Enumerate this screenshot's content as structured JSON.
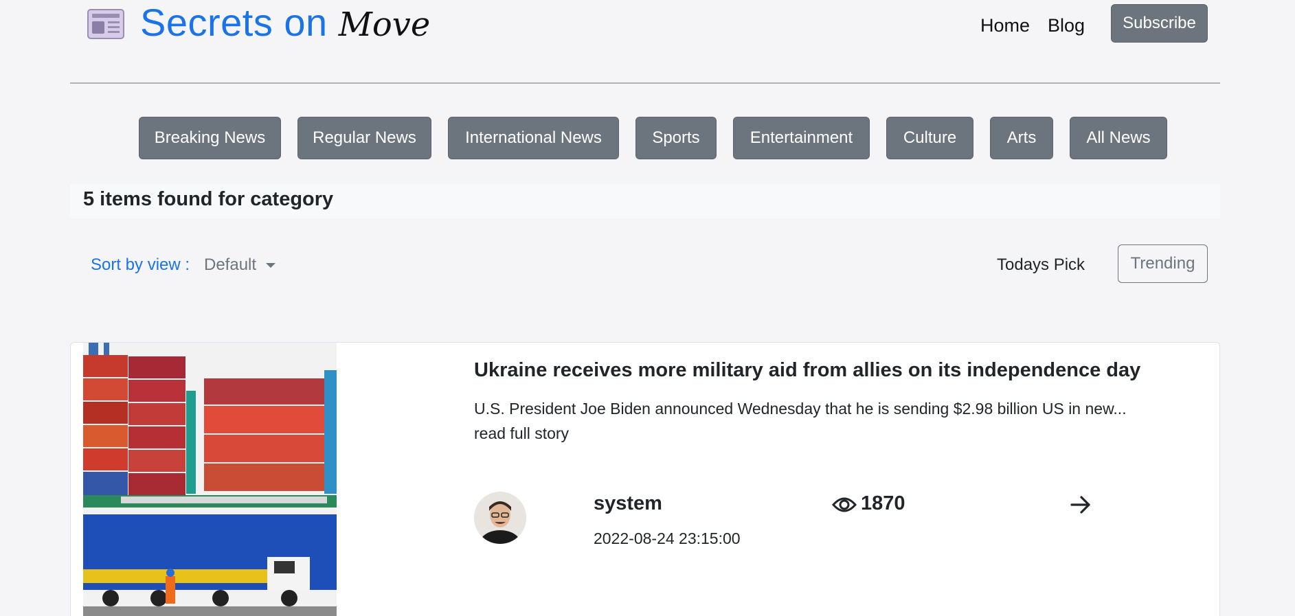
{
  "header": {
    "logo_main": "Secrets on",
    "logo_script": "Move",
    "nav": {
      "home": "Home",
      "blog": "Blog"
    },
    "subscribe_label": "Subscribe"
  },
  "categories": [
    "Breaking News",
    "Regular News",
    "International News",
    "Sports",
    "Entertainment",
    "Culture",
    "Arts",
    "All News"
  ],
  "result_text": "5 items found for category",
  "sort": {
    "label": "Sort by view :",
    "selected": "Default",
    "todays_pick": "Todays Pick",
    "trending": "Trending"
  },
  "articles": [
    {
      "title": "Ukraine receives more military aid from allies on its independence day",
      "excerpt": "U.S. President Joe Biden announced Wednesday that he is sending $2.98 billion US in new... read full story",
      "author": "system",
      "date": "2022-08-24 23:15:00",
      "views": "1870",
      "image_icon": "container-ship-photo",
      "eye_icon": "eye-icon",
      "arrow_icon": "arrow-right-icon"
    }
  ],
  "colors": {
    "accent": "#1a73e8",
    "button_gray": "#6c757d",
    "background": "#f5f5f7"
  }
}
